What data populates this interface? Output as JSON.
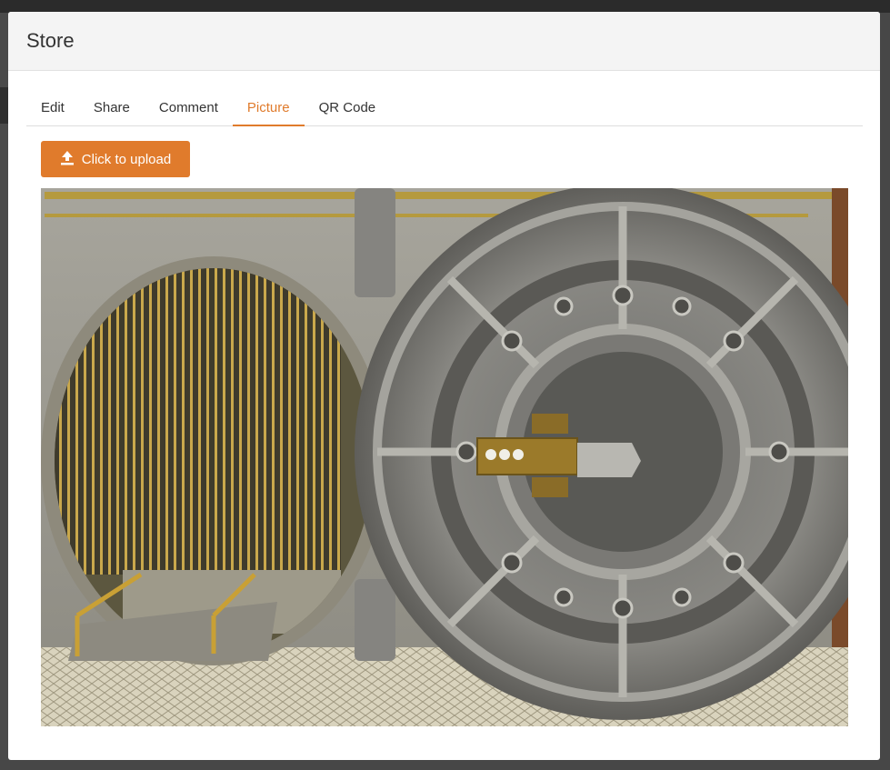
{
  "modal": {
    "title": "Store"
  },
  "tabs": [
    {
      "label": "Edit",
      "active": false
    },
    {
      "label": "Share",
      "active": false
    },
    {
      "label": "Comment",
      "active": false
    },
    {
      "label": "Picture",
      "active": true
    },
    {
      "label": "QR Code",
      "active": false
    }
  ],
  "upload": {
    "label": "Click to upload",
    "icon": "upload-icon"
  },
  "picture": {
    "subject": "bank-vault-door"
  },
  "colors": {
    "accent": "#e07b2c",
    "header_bg": "#f4f4f4",
    "overlay": "#3a3a3a"
  }
}
